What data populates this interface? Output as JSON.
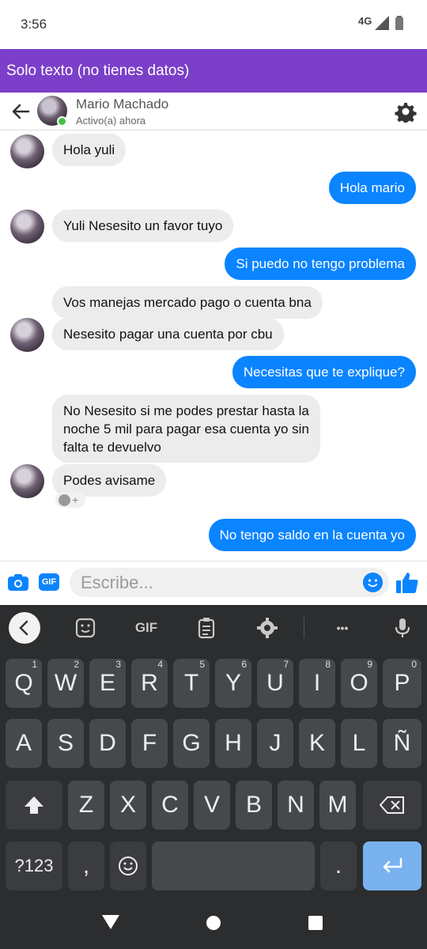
{
  "status_bar": {
    "time": "3:56",
    "network": "4G"
  },
  "banner": {
    "text": "Solo texto (no tienes datos)"
  },
  "header": {
    "contact_name": "Mario Machado",
    "contact_status": "Activo(a) ahora"
  },
  "messages": [
    {
      "side": "in",
      "text": "Hola yuli"
    },
    {
      "side": "out",
      "text": "Hola mario"
    },
    {
      "side": "in",
      "text": "Yuli Nesesito un favor tuyo"
    },
    {
      "side": "out",
      "text": "Si puedo no tengo problema"
    },
    {
      "side": "in",
      "text": "Vos manejas mercado pago o cuenta bna"
    },
    {
      "side": "in",
      "text": "Nesesito pagar una cuenta por cbu"
    },
    {
      "side": "out",
      "text": "Necesitas que te explique?"
    },
    {
      "side": "in",
      "lines": [
        "No Nesesito si me podes prestar hasta la",
        "noche 5 mil para pagar esa cuenta yo sin",
        "falta te devuelvo"
      ]
    },
    {
      "side": "in",
      "text": "Podes avisame"
    },
    {
      "side": "out",
      "text": "No tengo saldo en la cuenta yo"
    }
  ],
  "reaction": {
    "plus": "+"
  },
  "composer": {
    "placeholder": "Escribe...",
    "gif_label": "GIF"
  },
  "keyboard": {
    "toolbar_gif": "GIF",
    "toolbar_more": "•••",
    "row1": [
      {
        "key": "Q",
        "hint": "1"
      },
      {
        "key": "W",
        "hint": "2"
      },
      {
        "key": "E",
        "hint": "3"
      },
      {
        "key": "R",
        "hint": "4"
      },
      {
        "key": "T",
        "hint": "5"
      },
      {
        "key": "Y",
        "hint": "6"
      },
      {
        "key": "U",
        "hint": "7"
      },
      {
        "key": "I",
        "hint": "8"
      },
      {
        "key": "O",
        "hint": "9"
      },
      {
        "key": "P",
        "hint": "0"
      }
    ],
    "row2": [
      "A",
      "S",
      "D",
      "F",
      "G",
      "H",
      "J",
      "K",
      "L",
      "Ñ"
    ],
    "row3": [
      "Z",
      "X",
      "C",
      "V",
      "B",
      "N",
      "M"
    ],
    "symbols": "?123",
    "comma": ",",
    "period": "."
  },
  "colors": {
    "banner": "#7b3fc9",
    "outgoing_bubble": "#0a84ff",
    "incoming_bubble": "#ececec",
    "keyboard_bg": "#2b2d2f",
    "online": "#3fc33f"
  }
}
